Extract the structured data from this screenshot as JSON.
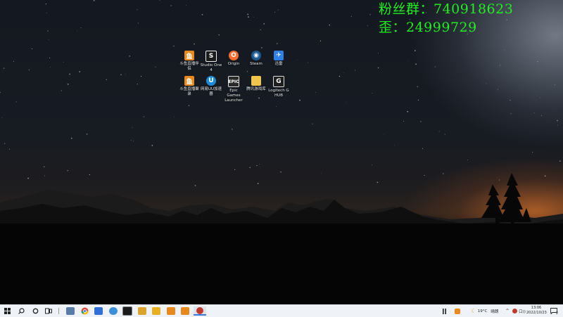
{
  "overlay": {
    "line1": "粉丝群：740918623",
    "line2": "歪：24999729",
    "color": "#22ee22"
  },
  "desktop_icons": [
    {
      "label": "斗鱼直播伴侣",
      "icon": "douyu-icon",
      "color": "#e8891e"
    },
    {
      "label": "Studio One 4",
      "icon": "studio-one-icon",
      "color": "#1b1b1b"
    },
    {
      "label": "Origin",
      "icon": "origin-icon",
      "color": "#f56c2d"
    },
    {
      "label": "Steam",
      "icon": "steam-icon",
      "color": "#1b5b93"
    },
    {
      "label": "迅雷",
      "icon": "xunlei-icon",
      "color": "#2e7fe8"
    },
    {
      "label": "斗鱼直播聚录",
      "icon": "douyu-record-icon",
      "color": "#e8891e"
    },
    {
      "label": "网易UU加速器",
      "icon": "uu-accelerator-icon",
      "color": "#1d8ad8"
    },
    {
      "label": "Epic Games Launcher",
      "icon": "epic-games-icon",
      "color": "#2a2a2a"
    },
    {
      "label": "腾讯游戏库",
      "icon": "folder-icon",
      "color": "#f0c64a"
    },
    {
      "label": "Logitech G HUB",
      "icon": "logitech-ghub-icon",
      "color": "#1f1f1f"
    }
  ],
  "taskbar": {
    "pinned": [
      {
        "name": "file-manager-icon",
        "color": "#5a7ba8"
      },
      {
        "name": "chrome-icon",
        "color": "#dd4b39"
      },
      {
        "name": "app-blue-icon",
        "color": "#2f6fd6"
      },
      {
        "name": "studio-one-icon",
        "color": "#1b1b1b"
      },
      {
        "name": "app-cloud-icon",
        "color": "#3b8fd9"
      },
      {
        "name": "game-icon",
        "color": "#d9a32c"
      },
      {
        "name": "app-yellow-icon",
        "color": "#e7b021"
      },
      {
        "name": "douyu-icon",
        "color": "#e8891e"
      },
      {
        "name": "douyu-record-icon",
        "color": "#e8891e"
      },
      {
        "name": "app-red-icon",
        "color": "#c0392b"
      }
    ],
    "weather_temp": "19°C",
    "weather_text": "晴朗",
    "ime": "中",
    "volume": "口))",
    "time": "13:06",
    "date": "2022/10/23",
    "notif": "2"
  }
}
